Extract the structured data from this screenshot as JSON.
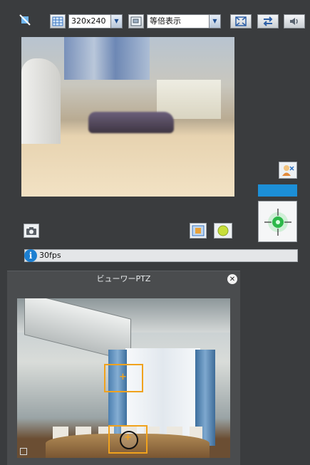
{
  "toolbar": {
    "resolution_value": "320x240",
    "display_mode_value": "等倍表示"
  },
  "status": {
    "text": "30fps"
  },
  "ptz": {
    "title": "ビューワーPTZ"
  },
  "icons": {
    "mute_camera": "camera-off-icon",
    "resolution": "grid-icon",
    "display_mode": "zoom-view-icon",
    "fullscreen": "expand-icon",
    "switch": "swap-arrows-icon",
    "audio": "speaker-icon",
    "person": "person-icon",
    "snapshot": "camera-icon",
    "record": "record-icon",
    "pan_target": "target-icon",
    "info": "info-icon",
    "close": "close-icon"
  },
  "colors": {
    "accent_blue": "#1c8fd7",
    "ptz_frame": "#f0a21d",
    "target_green": "#2db84a"
  }
}
